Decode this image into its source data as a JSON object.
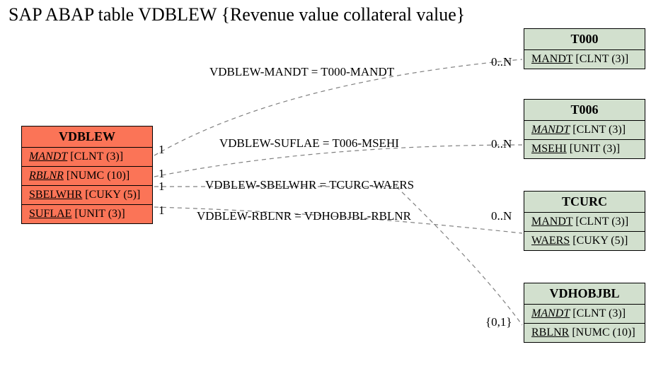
{
  "title": "SAP ABAP table VDBLEW {Revenue value collateral value}",
  "main": {
    "name": "VDBLEW",
    "fields": [
      {
        "name": "MANDT",
        "type": "[CLNT (3)]",
        "ital": true
      },
      {
        "name": "RBLNR",
        "type": "[NUMC (10)]",
        "ital": true
      },
      {
        "name": "SBELWHR",
        "type": "[CUKY (5)]",
        "ital": false
      },
      {
        "name": "SUFLAE",
        "type": "[UNIT (3)]",
        "ital": false
      }
    ]
  },
  "refs": [
    {
      "name": "T000",
      "fields": [
        {
          "name": "MANDT",
          "type": "[CLNT (3)]",
          "ital": false
        }
      ]
    },
    {
      "name": "T006",
      "fields": [
        {
          "name": "MANDT",
          "type": "[CLNT (3)]",
          "ital": true
        },
        {
          "name": "MSEHI",
          "type": "[UNIT (3)]",
          "ital": false
        }
      ]
    },
    {
      "name": "TCURC",
      "fields": [
        {
          "name": "MANDT",
          "type": "[CLNT (3)]",
          "ital": false
        },
        {
          "name": "WAERS",
          "type": "[CUKY (5)]",
          "ital": false
        }
      ]
    },
    {
      "name": "VDHOBJBL",
      "fields": [
        {
          "name": "MANDT",
          "type": "[CLNT (3)]",
          "ital": true
        },
        {
          "name": "RBLNR",
          "type": "[NUMC (10)]",
          "ital": false
        }
      ]
    }
  ],
  "edges": [
    {
      "label": "VDBLEW-MANDT = T000-MANDT",
      "left": "1",
      "right": "0..N"
    },
    {
      "label": "VDBLEW-SUFLAE = T006-MSEHI",
      "left": "1",
      "right": "0..N"
    },
    {
      "label": "VDBLEW-SBELWHR = TCURC-WAERS",
      "left": "1",
      "right": ""
    },
    {
      "label": "VDBLEW-RBLNR = VDHOBJBL-RBLNR",
      "left": "1",
      "right": "0..N"
    }
  ],
  "extra_right": "{0,1}"
}
